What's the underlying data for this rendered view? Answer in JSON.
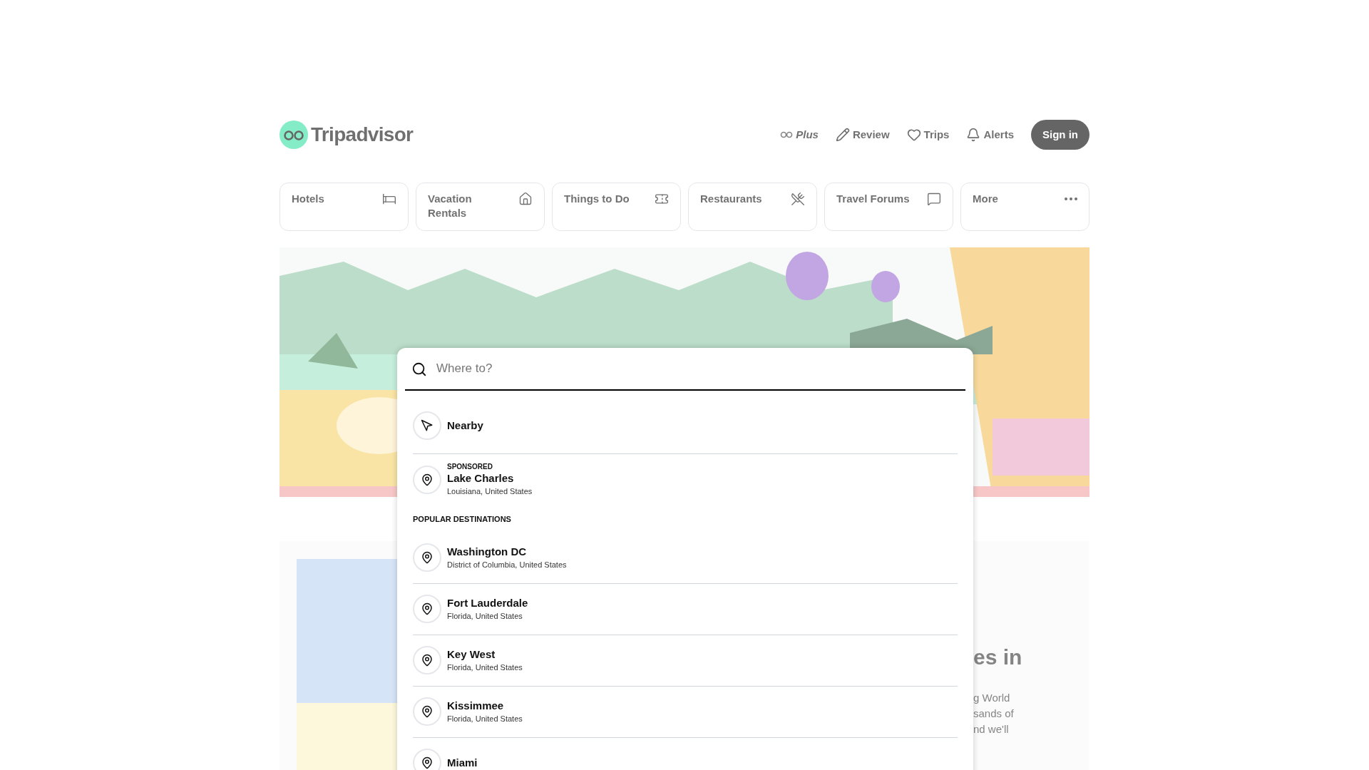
{
  "header": {
    "logo": "Tripadvisor",
    "nav": [
      {
        "kind": "plus",
        "label": "Plus"
      },
      {
        "kind": "review",
        "label": "Review"
      },
      {
        "kind": "trips",
        "label": "Trips"
      },
      {
        "kind": "alerts",
        "label": "Alerts"
      }
    ],
    "sign_in": "Sign in"
  },
  "categories": [
    {
      "kind": "hotels",
      "label": "Hotels"
    },
    {
      "kind": "rentals",
      "label": "Vacation Rentals"
    },
    {
      "kind": "things",
      "label": "Things to Do"
    },
    {
      "kind": "restaurants",
      "label": "Restaurants"
    },
    {
      "kind": "forums",
      "label": "Travel Forums"
    },
    {
      "kind": "more",
      "label": "More"
    }
  ],
  "background_section": {
    "heading": "es in",
    "text_lines": [
      "g World",
      "sands of",
      "nd we'll"
    ]
  },
  "search": {
    "placeholder": "Where to?"
  },
  "suggestions": [
    {
      "kind": "nearby",
      "title": "Nearby"
    },
    {
      "kind": "sponsored",
      "badge": "SPONSORED",
      "title": "Lake Charles",
      "subtitle": "Louisiana, United States"
    }
  ],
  "popular": {
    "heading": "POPULAR DESTINATIONS",
    "items": [
      {
        "title": "Washington DC",
        "subtitle": "District of Columbia, United States"
      },
      {
        "title": "Fort Lauderdale",
        "subtitle": "Florida, United States"
      },
      {
        "title": "Key West",
        "subtitle": "Florida, United States"
      },
      {
        "title": "Kissimmee",
        "subtitle": "Florida, United States"
      },
      {
        "title": "Miami"
      }
    ]
  }
}
